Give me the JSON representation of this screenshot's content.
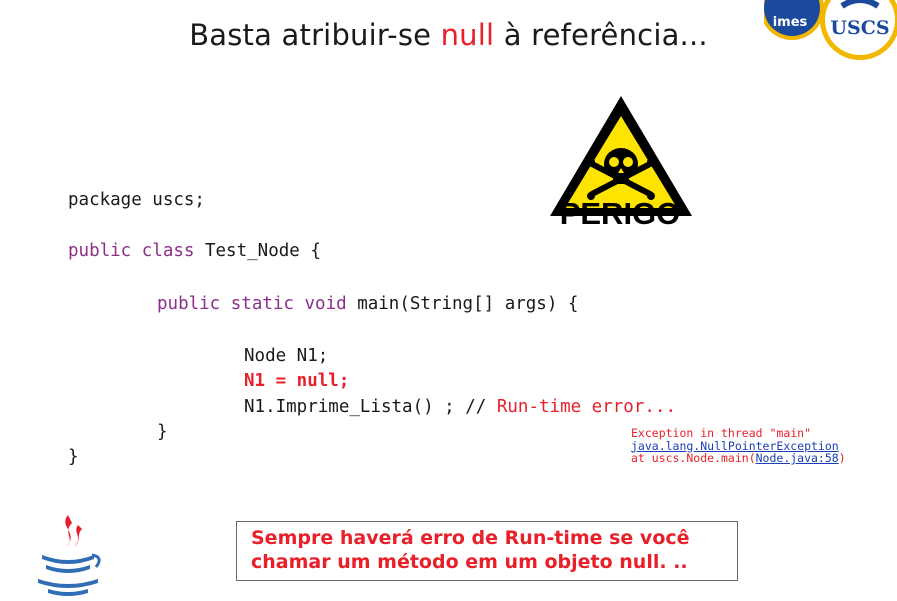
{
  "slide": {
    "title_before": "Basta atribuir-se ",
    "title_highlight": "null",
    "title_after": " à referência...",
    "warning_label": "PERIGO",
    "logo": {
      "left_text": "imes",
      "right_text": "USCS"
    }
  },
  "code": {
    "line1": "package uscs;",
    "line2_kw": "public class",
    "line2_rest": " Test_Node {",
    "line3_kw": "public static void",
    "line3_rest": " main(String[] args) {",
    "line4": "Node N1;",
    "line5": "N1 = null;",
    "line6_code": "N1.Imprime_Lista() ; //",
    "line6_comment": " Run-time error...",
    "line7": "}",
    "line8": "}"
  },
  "exception": {
    "line1": "Exception in thread \"main\"",
    "line2": "java.lang.NullPointerException",
    "line3_prefix": "at uscs.Node.main(",
    "line3_link": "Node.java:58",
    "line3_suffix": ")"
  },
  "note": {
    "line1": "Sempre haverá erro de Run-time se você",
    "line2": "chamar um método em um objeto null. .."
  },
  "colors": {
    "accent_red": "#e8202a",
    "keyword": "#8b2f8b",
    "link_blue": "#1a3fb4",
    "warning_yellow": "#ffe400"
  }
}
